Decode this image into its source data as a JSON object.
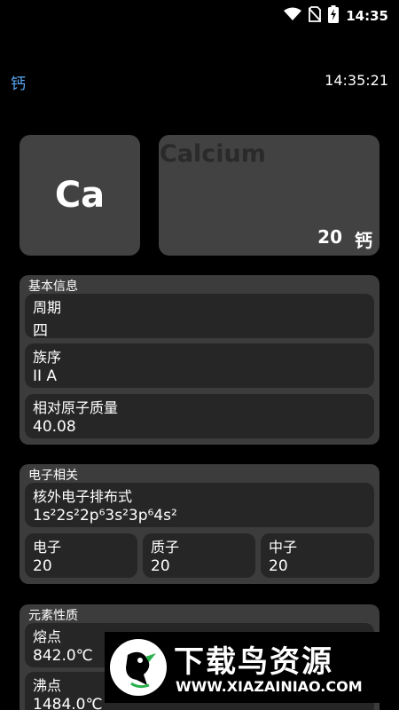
{
  "status_bar": {
    "time": "14:35",
    "icons": [
      "wifi-icon",
      "no-sim-icon",
      "battery-charging-icon"
    ]
  },
  "header": {
    "title": "钙",
    "clock": "14:35:21"
  },
  "element": {
    "symbol": "Ca",
    "name_en": "Calcium",
    "atomic_number": "20",
    "name_cn": "钙"
  },
  "basic_info": {
    "title": "基本信息",
    "items": [
      {
        "label": "周期",
        "value": "四"
      },
      {
        "label": "族序",
        "value": "II A"
      },
      {
        "label": "相对原子质量",
        "value": "40.08"
      }
    ]
  },
  "electron": {
    "title": "电子相关",
    "config_label": "核外电子排布式",
    "config_value": "1s²2s²2p⁶3s²3p⁶4s²",
    "counts": [
      {
        "label": "电子",
        "value": "20"
      },
      {
        "label": "质子",
        "value": "20"
      },
      {
        "label": "中子",
        "value": "20"
      }
    ]
  },
  "properties": {
    "title": "元素性质",
    "items": [
      {
        "label": "熔点",
        "value": "842.0℃"
      },
      {
        "label": "沸点",
        "value": "1484.0℃"
      }
    ]
  },
  "watermark": {
    "title": "下载鸟资源",
    "url": "WWW.XIAZAINIAO.COM"
  }
}
